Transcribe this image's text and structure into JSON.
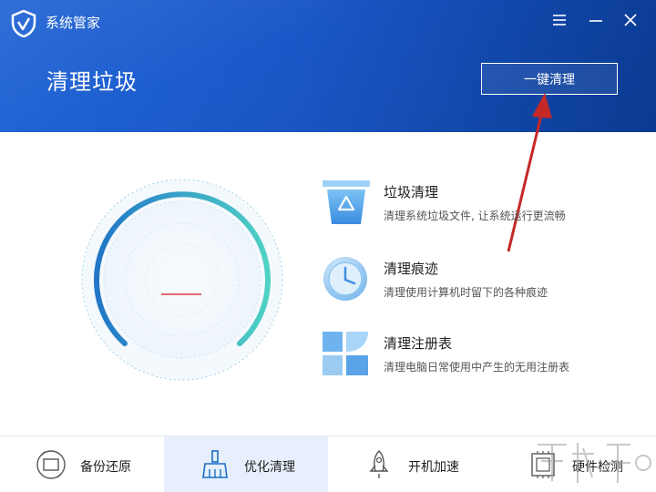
{
  "app": {
    "title": "系统管家"
  },
  "header": {
    "page_title": "清理垃圾",
    "clean_button_label": "一键清理"
  },
  "gauge": {
    "center_value": "—"
  },
  "features": [
    {
      "title": "垃圾清理",
      "description": "清理系统垃圾文件, 让系统运行更流畅",
      "icon": "trash-icon"
    },
    {
      "title": "清理痕迹",
      "description": "清理使用计算机时留下的各种痕迹",
      "icon": "clock-icon"
    },
    {
      "title": "清理注册表",
      "description": "清理电脑日常使用中产生的无用注册表",
      "icon": "registry-icon"
    }
  ],
  "tabs": [
    {
      "label": "备份还原",
      "icon": "backup-icon",
      "active": false
    },
    {
      "label": "优化清理",
      "icon": "broom-icon",
      "active": true
    },
    {
      "label": "开机加速",
      "icon": "rocket-icon",
      "active": false
    },
    {
      "label": "硬件检测",
      "icon": "chip-icon",
      "active": false
    }
  ],
  "colors": {
    "header_blue": "#1a58c9",
    "gauge_start": "#2176c7",
    "gauge_end": "#4fd1c5",
    "arrow_red": "#c62828",
    "active_tab_bg": "#e6effb"
  }
}
